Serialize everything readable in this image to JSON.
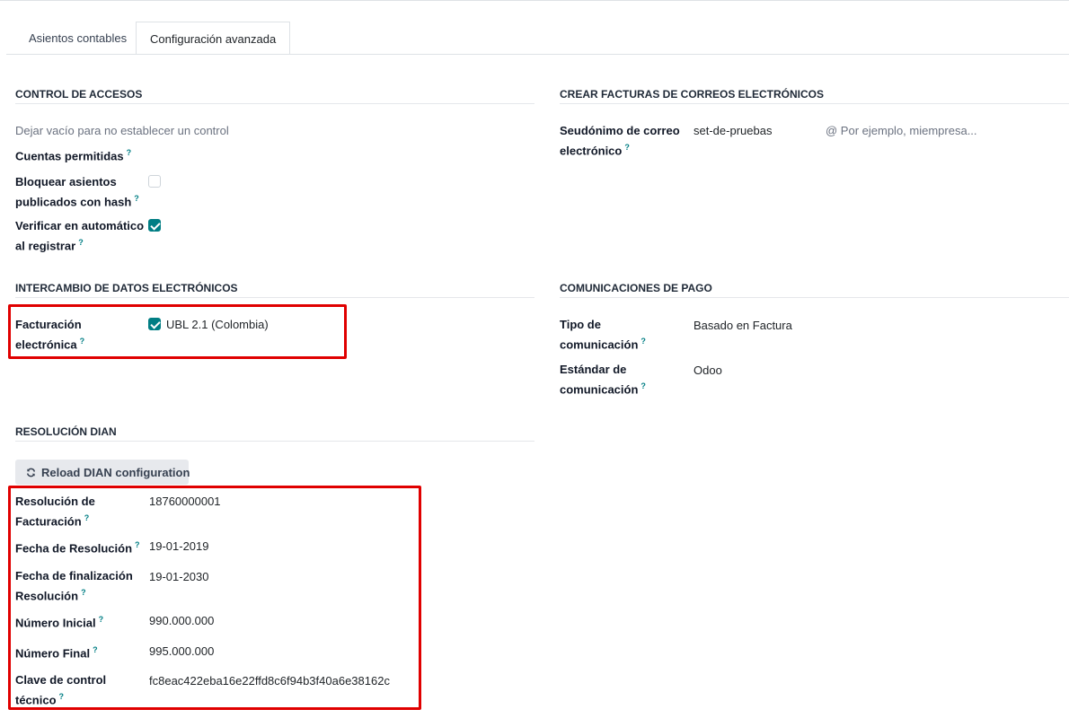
{
  "tabs": [
    {
      "label": "Asientos contables",
      "active": false
    },
    {
      "label": "Configuración avanzada",
      "active": true
    }
  ],
  "access_control": {
    "title": "CONTROL DE ACCESOS",
    "hint": "Dejar vacío para no establecer un control",
    "allowed_accounts_label": "Cuentas permitidas",
    "lock_hash_label_1": "Bloquear asientos",
    "lock_hash_label_2": "publicados con hash",
    "lock_hash_checked": false,
    "auto_verify_label_1": "Verificar en automático",
    "auto_verify_label_2": "al registrar",
    "auto_verify_checked": true
  },
  "email_invoices": {
    "title": "CREAR FACTURAS DE CORREOS ELECTRÓNICOS",
    "alias_label_1": "Seudónimo de correo",
    "alias_label_2": "electrónico",
    "alias_value": "set-de-pruebas",
    "domain_placeholder": "@ Por ejemplo, miempresa..."
  },
  "edi": {
    "title": "INTERCAMBIO DE DATOS ELECTRÓNICOS",
    "label_1": "Facturación",
    "label_2": "electrónica",
    "option_label": "UBL 2.1 (Colombia)",
    "option_checked": true
  },
  "payment": {
    "title": "COMUNICACIONES DE PAGO",
    "type_label_1": "Tipo de",
    "type_label_2": "comunicación",
    "type_value": "Basado en Factura",
    "standard_label_1": "Estándar de",
    "standard_label_2": "comunicación",
    "standard_value": "Odoo"
  },
  "dian": {
    "title": "RESOLUCIÓN DIAN",
    "reload_label": "Reload DIAN configuration",
    "resolution_label_1": "Resolución de",
    "resolution_label_2": "Facturación",
    "resolution_value": "18760000001",
    "resolution_date_label": "Fecha de Resolución",
    "resolution_date_value": "19-01-2019",
    "end_date_label_1": "Fecha de finalización",
    "end_date_label_2": "Resolución",
    "end_date_value": "19-01-2030",
    "start_number_label": "Número Inicial",
    "start_number_value": "990.000.000",
    "end_number_label": "Número Final",
    "end_number_value": "995.000.000",
    "tech_key_label_1": "Clave de control",
    "tech_key_label_2": "técnico",
    "tech_key_value": "fc8eac422eba16e22ffd8c6f94b3f40a6e38162c"
  },
  "help_mark": "?",
  "colors": {
    "accent": "#017e84",
    "highlight": "#e00000"
  }
}
